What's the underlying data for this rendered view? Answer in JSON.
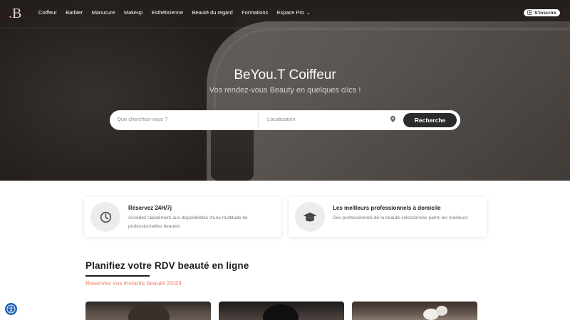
{
  "brand": {
    "logo_text": "B"
  },
  "nav": {
    "items": [
      {
        "label": "Coiffeur"
      },
      {
        "label": "Barbier"
      },
      {
        "label": "Manucure"
      },
      {
        "label": "Makeup"
      },
      {
        "label": "Esthéticienne"
      },
      {
        "label": "Beauté du regard"
      },
      {
        "label": "Formations"
      },
      {
        "label": "Espace Pro"
      }
    ],
    "signup_label": "S'inscrire"
  },
  "hero": {
    "title": "BeYou.T Coiffeur",
    "subtitle": "Vos rendez-vous Beauty en quelques clics !"
  },
  "search": {
    "what_placeholder": "Que cherchez-vous ?",
    "where_placeholder": "Localisation",
    "button_label": "Recherche"
  },
  "features": [
    {
      "icon": "clock-icon",
      "title": "Réservez 24H/7j",
      "description": "Accédez rapidement aux disponibilités d'une multitude de professionnelles beautés"
    },
    {
      "icon": "graduation-cap-icon",
      "title": "Les meilleurs professionnels à domicile",
      "description": "Des professionnels de la beauté sélectionnés parmi les meilleurs"
    }
  ],
  "section": {
    "title": "Planifiez votre RDV beauté en ligne",
    "subtitle": "Reservez vos instants beauté 24/24"
  },
  "colors": {
    "accent": "#e8826f",
    "search_button": "#2b2b2b",
    "accessibility_button": "#1f5fb6"
  }
}
